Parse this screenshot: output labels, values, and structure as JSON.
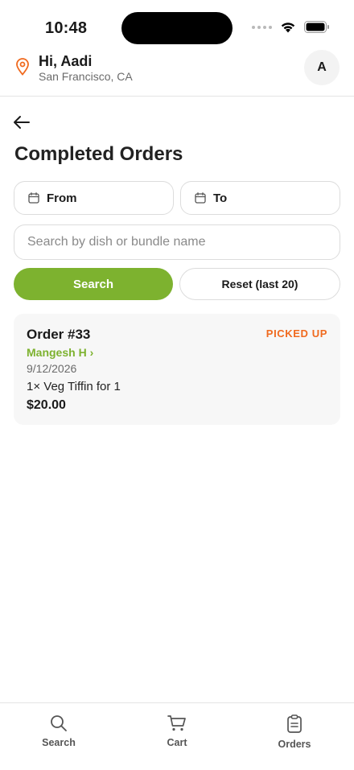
{
  "status_bar": {
    "time": "10:48"
  },
  "header": {
    "greeting": "Hi, Aadi",
    "location": "San Francisco, CA",
    "avatar_initial": "A"
  },
  "page": {
    "title": "Completed Orders"
  },
  "filters": {
    "from_label": "From",
    "to_label": "To",
    "search_placeholder": "Search by dish or bundle name",
    "search_button": "Search",
    "reset_button": "Reset (last 20)"
  },
  "orders": [
    {
      "number": "Order #33",
      "status": "PICKED UP",
      "vendor": "Mangesh H ›",
      "date": "9/12/2026",
      "item": "1× Veg Tiffin for 1",
      "price": "$20.00"
    }
  ],
  "tabbar": {
    "items": [
      {
        "label": "Search",
        "icon": "search-icon"
      },
      {
        "label": "Cart",
        "icon": "cart-icon"
      },
      {
        "label": "Orders",
        "icon": "clipboard-icon"
      }
    ]
  },
  "colors": {
    "accent_green": "#7db22f",
    "status_orange": "#f06a1f",
    "pin_orange": "#f06a1f"
  }
}
